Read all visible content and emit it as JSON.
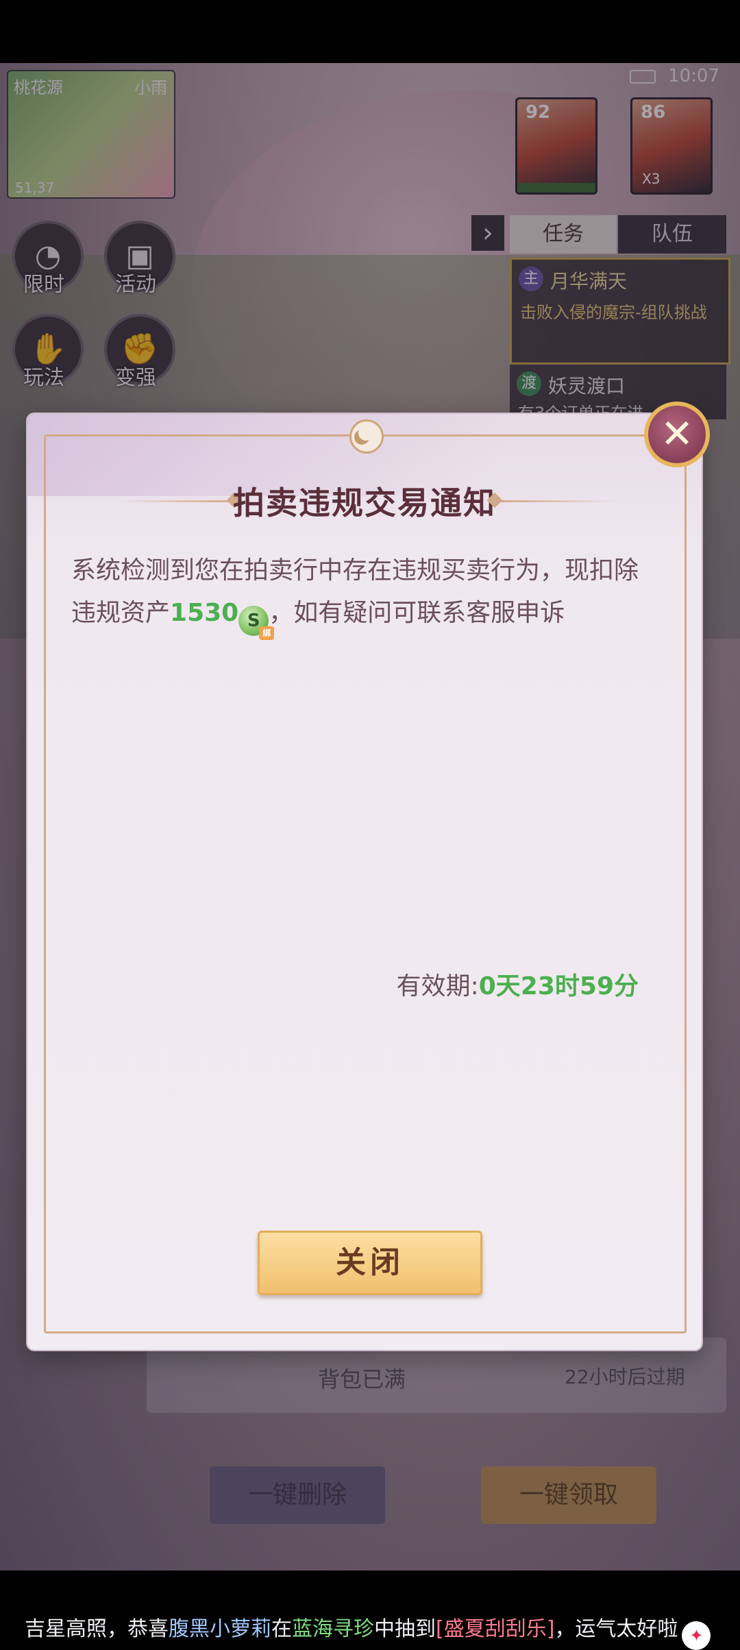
{
  "status_bar": {
    "time": "10:07"
  },
  "minimap": {
    "location": "桃花源",
    "weather": "小雨",
    "coords": "51,37"
  },
  "party": [
    {
      "level": "92"
    },
    {
      "level": "86",
      "multiplier": "X3"
    }
  ],
  "left_menu": [
    {
      "label": "限时",
      "icon": "clock-icon"
    },
    {
      "label": "活动",
      "icon": "gift-icon"
    },
    {
      "label": "玩法",
      "icon": "hand-icon"
    },
    {
      "label": "变强",
      "icon": "fist-icon"
    }
  ],
  "task_panel": {
    "tabs": [
      "任务",
      "队伍"
    ],
    "tasks": [
      {
        "badge": "主",
        "name": "月华满天",
        "desc": "击败入侵的魔宗-组队挑战"
      },
      {
        "badge": "渡",
        "name": "妖灵渡口",
        "desc": "有3个订单正在进"
      }
    ]
  },
  "background_mail": {
    "row_text": "背包已满",
    "row_time": "22小时后过期",
    "delete_all": "一键删除",
    "claim_all": "一键领取"
  },
  "dialog": {
    "title": "拍卖违规交易通知",
    "message_prefix": "系统检测到您在拍卖行中存在违规买卖行为，现扣除违规资产",
    "amount": "1530",
    "coin_tag": "绑",
    "message_suffix": "，如有疑问可联系客服申诉",
    "validity_label": "有效期:",
    "validity_value": "0天23时59分",
    "close_label": "关闭",
    "close_icon": "close-x-icon"
  },
  "broadcast": {
    "part1": "吉星高照，恭喜",
    "player": "腹黑小萝莉",
    "part2": "在",
    "activity": "蓝海寻珍",
    "part3": "中抽到",
    "reward": "[盛夏刮刮乐]",
    "part4": "，运气太好啦"
  },
  "colors": {
    "accent_green": "#4caf50",
    "title_color": "#5a2f3a",
    "button_gold": "#f1bf6c"
  }
}
